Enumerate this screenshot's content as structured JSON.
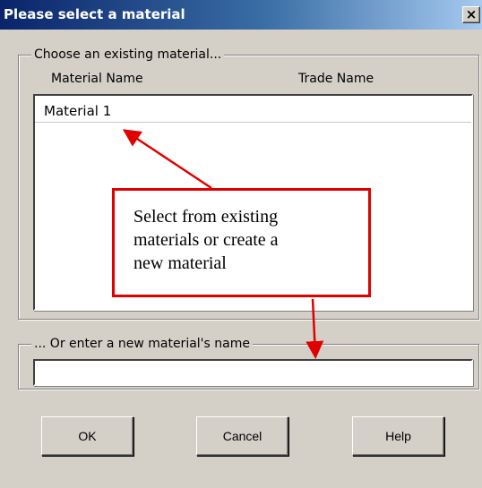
{
  "dialog": {
    "title": "Please select a material",
    "close_label": "×"
  },
  "existing_group": {
    "legend": "Choose an existing material...",
    "columns": [
      "Material Name",
      "Trade Name"
    ],
    "items": [
      "Material 1"
    ]
  },
  "new_group": {
    "legend": "... Or enter a new material's name",
    "value": ""
  },
  "buttons": {
    "ok": "OK",
    "cancel": "Cancel",
    "help": "Help"
  },
  "annotation": {
    "lines": [
      "Select from existing",
      "materials or create a",
      "new material"
    ],
    "color": "#e00000"
  }
}
